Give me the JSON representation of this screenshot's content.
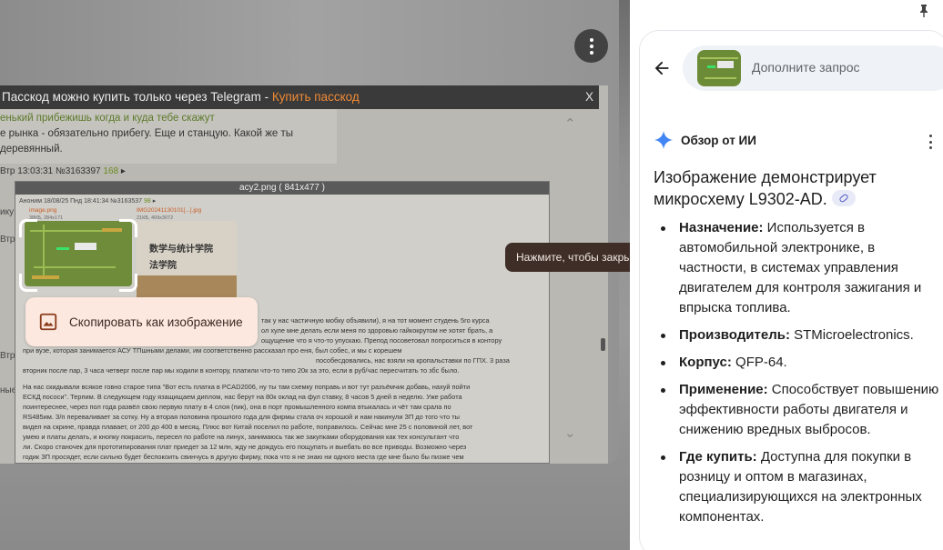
{
  "viewer": {
    "banner_text": "Пасскод можно купить только через Telegram - ",
    "banner_link": "Купить пасскод",
    "banner_close": "X",
    "post1_line1": "енький прибежишь когда и куда тебе скажут",
    "post1_line2": "е рынка - обязательно прибегу. Еще и станцую. Какой же ты деревянный.",
    "post_meta": "Втр 13:03:31 №3163397",
    "post_meta_num": "168",
    "side_labels": [
      "Втр",
      "ику",
      "Втр",
      "Втр",
      "Втр",
      "ные рта"
    ],
    "popup_title": "acy2.png ( 841x477 )",
    "popup_meta": "Аноним 18/08/25 Пнд 18:41:34 №3163537",
    "popup_meta_num": "98",
    "file1": "image.png",
    "file2": "IMG20241130101[...].jpg",
    "file1_size": "38КБ, 284х171",
    "file2_size": "21КБ, 409x3072",
    "logo_sign1": "数学与统计学院",
    "logo_sign2": "法学院",
    "text_lines": [
      "так у нас частичную мобку объявили), я на тот момент студень 5го курса",
      "ол хуле мне делать если меня по здоровью гайкокрутом не хотят брать, а",
      "ощущение что я что-то упускаю. Препод посоветовал попроситься в контору",
      "при вузе, которая занимается АСУ ТПшными делами, им соответственно рассказал про еня, был собес, и мы с корешем",
      "пособесдовались, нас взяли на кропальставки по ГПХ. 3 раза",
      "вторник после пар, 3 часа четверг после пар мы ходили в контору, платили что-то типо 20к за это, если в руб/час пересчитать то збс было.",
      "На нас скидывали всякое говно старое типа \"Вот есть платка в PCAD2006, ну ты там схемку поправь и вот тут разъёмчик добавь, нахуй пойти",
      "ЕСКД пососи\". Терпим. В следующем году язащищаем диплом, нас берут на 80к оклад на фул ставку, 8 часов 5 дней в неделю. Уже работа",
      "поинтереснее, через пол года развёл свою первую плату в 4 слоя (пик), она в порт промышленного компа втыкалась и чёт там срала по",
      "RS485им. З/п переваливает за сотку. Ну а вторая половина прошлого года для фирмы стала оч хорошой и нам накинули ЗП до того что ты",
      "видел на скрине, правда плавает, от 200 до 400 в месяц. Плюс вот Китай поселил по работе, поправилось. Сейчас мне 25 с половиной лет, вот",
      "умею и платы делать, и кнопку покрасить, пересел по работе на линух, занимаюсь так же закупками оборудования как тех консультант что",
      "ли. Скоро станочек для прототипирования плат приедет за 12 млн, жду не дождусь его пощупать и выебать во все приводы. Возможно через",
      "годик ЗП просядет, если сильно будет беспокоить свинчусь в другую фирму, пока что я не знаю ни одного места где мне было бы пизже чем"
    ],
    "copy_button": "Скопировать как изображение",
    "tooltip": "Нажмите, чтобы закрыть"
  },
  "panel": {
    "search_placeholder": "Дополните запрос",
    "ai_title": "Обзор от ИИ",
    "summary": "Изображение демонстрирует микросхему L9302-AD.",
    "bullets": [
      {
        "label": "Назначение:",
        "text": " Используется в автомобильной электронике, в частности, в системах управления двигателем для контроля зажигания и впрыска топлива."
      },
      {
        "label": "Производитель:",
        "text": " STMicroelectronics."
      },
      {
        "label": "Корпус:",
        "text": " QFP-64."
      },
      {
        "label": "Применение:",
        "text": " Способствует повышению эффективности работы двигателя и снижению вредных выбросов."
      },
      {
        "label": "Где купить:",
        "text": " Доступна для покупки в розницу и оптом в магазинах, специализирующихся на электронных компонентах."
      }
    ]
  },
  "colors": {
    "accent_link": "#f08a35",
    "copy_button_bg": "#fce8de",
    "ai_star": "#4285f4",
    "tooltip_bg": "#3e2e27"
  },
  "icons": [
    "more-vert-icon",
    "image-icon",
    "arrow-back-icon",
    "sparkle-icon",
    "link-icon",
    "pin-icon"
  ]
}
